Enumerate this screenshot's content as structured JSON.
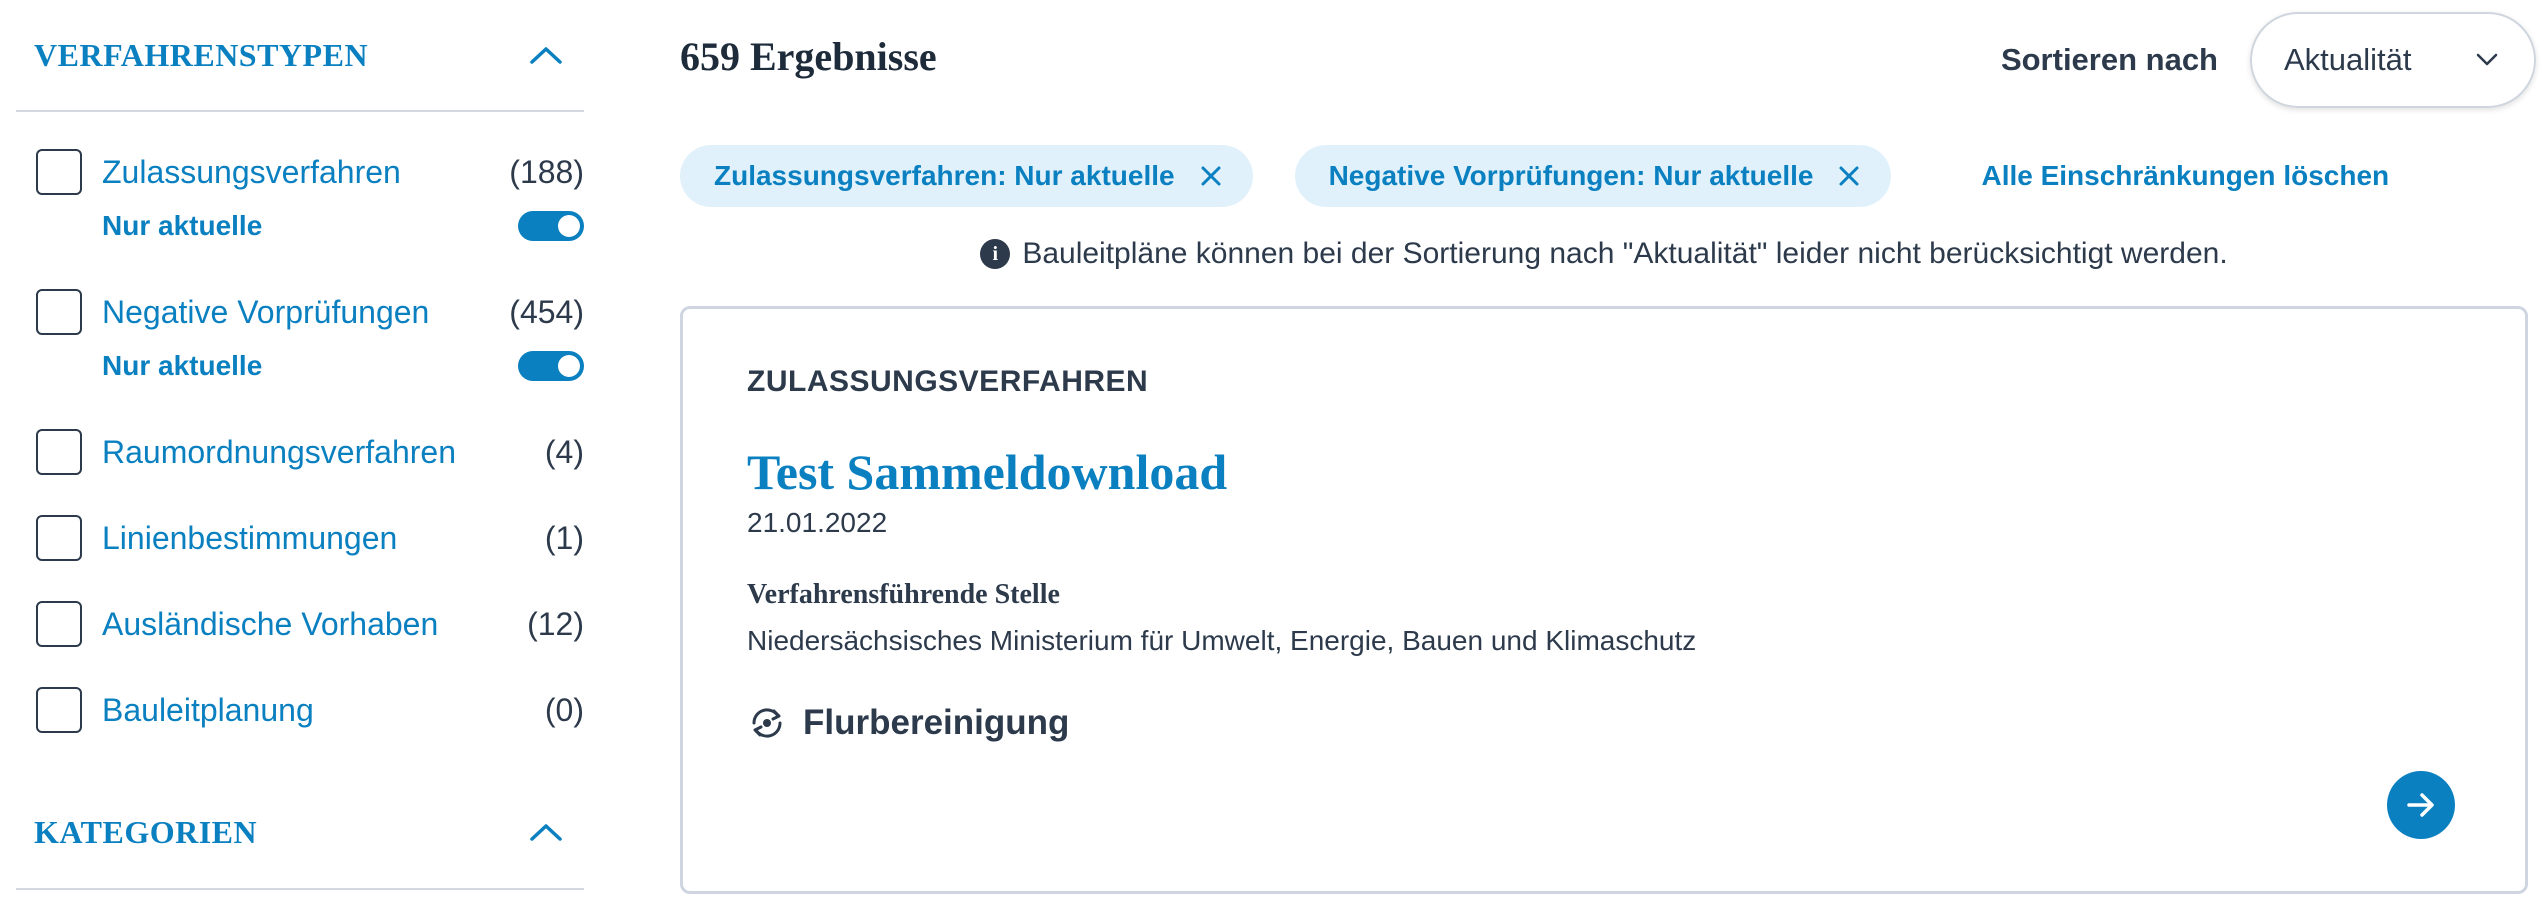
{
  "sidebar": {
    "procedure_types": {
      "title": "VERFAHRENSTYPEN",
      "items": [
        {
          "label": "Zulassungsverfahren",
          "count": "(188)",
          "sub_label": "Nur aktuelle",
          "sub_enabled": true
        },
        {
          "label": "Negative Vorprüfungen",
          "count": "(454)",
          "sub_label": "Nur aktuelle",
          "sub_enabled": true
        },
        {
          "label": "Raumordnungsverfahren",
          "count": "(4)"
        },
        {
          "label": "Linienbestimmungen",
          "count": "(1)"
        },
        {
          "label": "Ausländische Vorhaben",
          "count": "(12)"
        },
        {
          "label": "Bauleitplanung",
          "count": "(0)"
        }
      ]
    },
    "categories": {
      "title": "KATEGORIEN"
    }
  },
  "main": {
    "results_count": "659 Ergebnisse",
    "sort": {
      "label": "Sortieren nach",
      "value": "Aktualität"
    },
    "active_filters": [
      {
        "label": "Zulassungsverfahren: Nur aktuelle"
      },
      {
        "label": "Negative Vorprüfungen: Nur aktuelle"
      }
    ],
    "clear_all": "Alle Einschränkungen löschen",
    "notice": "Bauleitpläne können bei der Sortierung nach \"Aktualität\" leider nicht berücksichtigt werden.",
    "card": {
      "type": "ZULASSUNGSVERFAHREN",
      "title": "Test Sammeldownload",
      "date": "21.01.2022",
      "authority_heading": "Verfahrensführende Stelle",
      "authority": "Niedersächsisches Ministerium für Umwelt, Energie, Bauen und Klimaschutz",
      "category": "Flurbereinigung"
    }
  },
  "colors": {
    "accent": "#0a80c0",
    "text": "#2c3a4b",
    "chip_bg": "#e1f1fb",
    "border": "#cfd6e2"
  },
  "icons": [
    "chevron-up-icon",
    "chevron-down-icon",
    "close-icon",
    "info-icon",
    "land-consolidation-icon",
    "arrow-right-icon"
  ]
}
